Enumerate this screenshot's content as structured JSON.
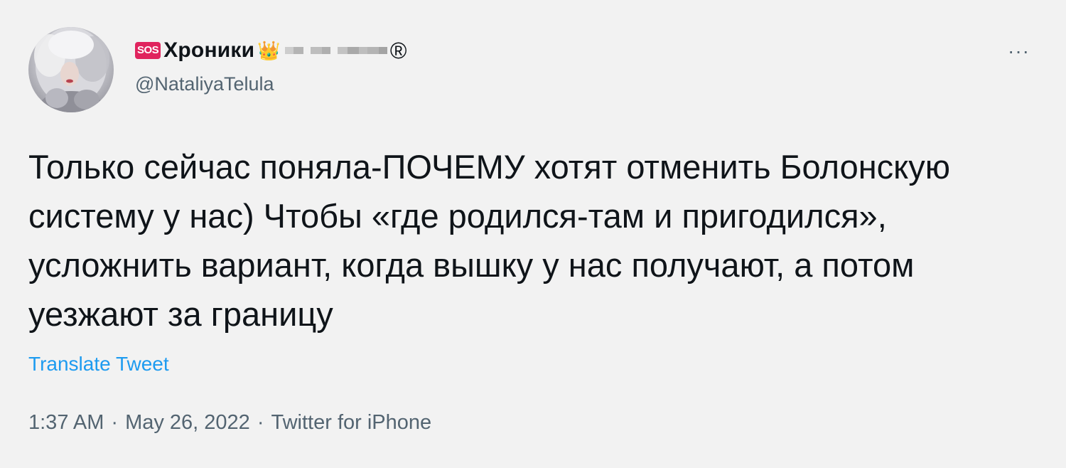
{
  "tweet": {
    "author": {
      "badge": "SOS",
      "name": "Хроники",
      "crown_emoji": "👑",
      "registered_mark": "®",
      "handle": "@NataliyaTelula"
    },
    "more_label": "···",
    "text": "Только сейчас поняла-ПОЧЕМУ хотят отменить Болонскую систему у нас) Чтобы «где родился-там и пригодился», усложнить вариант, когда вышку у нас получают, а потом уезжают за границу",
    "translate_label": "Translate Tweet",
    "meta": {
      "time": "1:37 AM",
      "separator": "·",
      "date": "May 26, 2022",
      "client": "Twitter for iPhone"
    }
  },
  "colors": {
    "background": "#f2f2f2",
    "text": "#0f1419",
    "secondary": "#536471",
    "link": "#1d9bf0",
    "badge": "#e0245e"
  },
  "icons": {
    "more": "ellipsis-icon",
    "avatar": "profile-photo",
    "badge": "sos-icon"
  }
}
